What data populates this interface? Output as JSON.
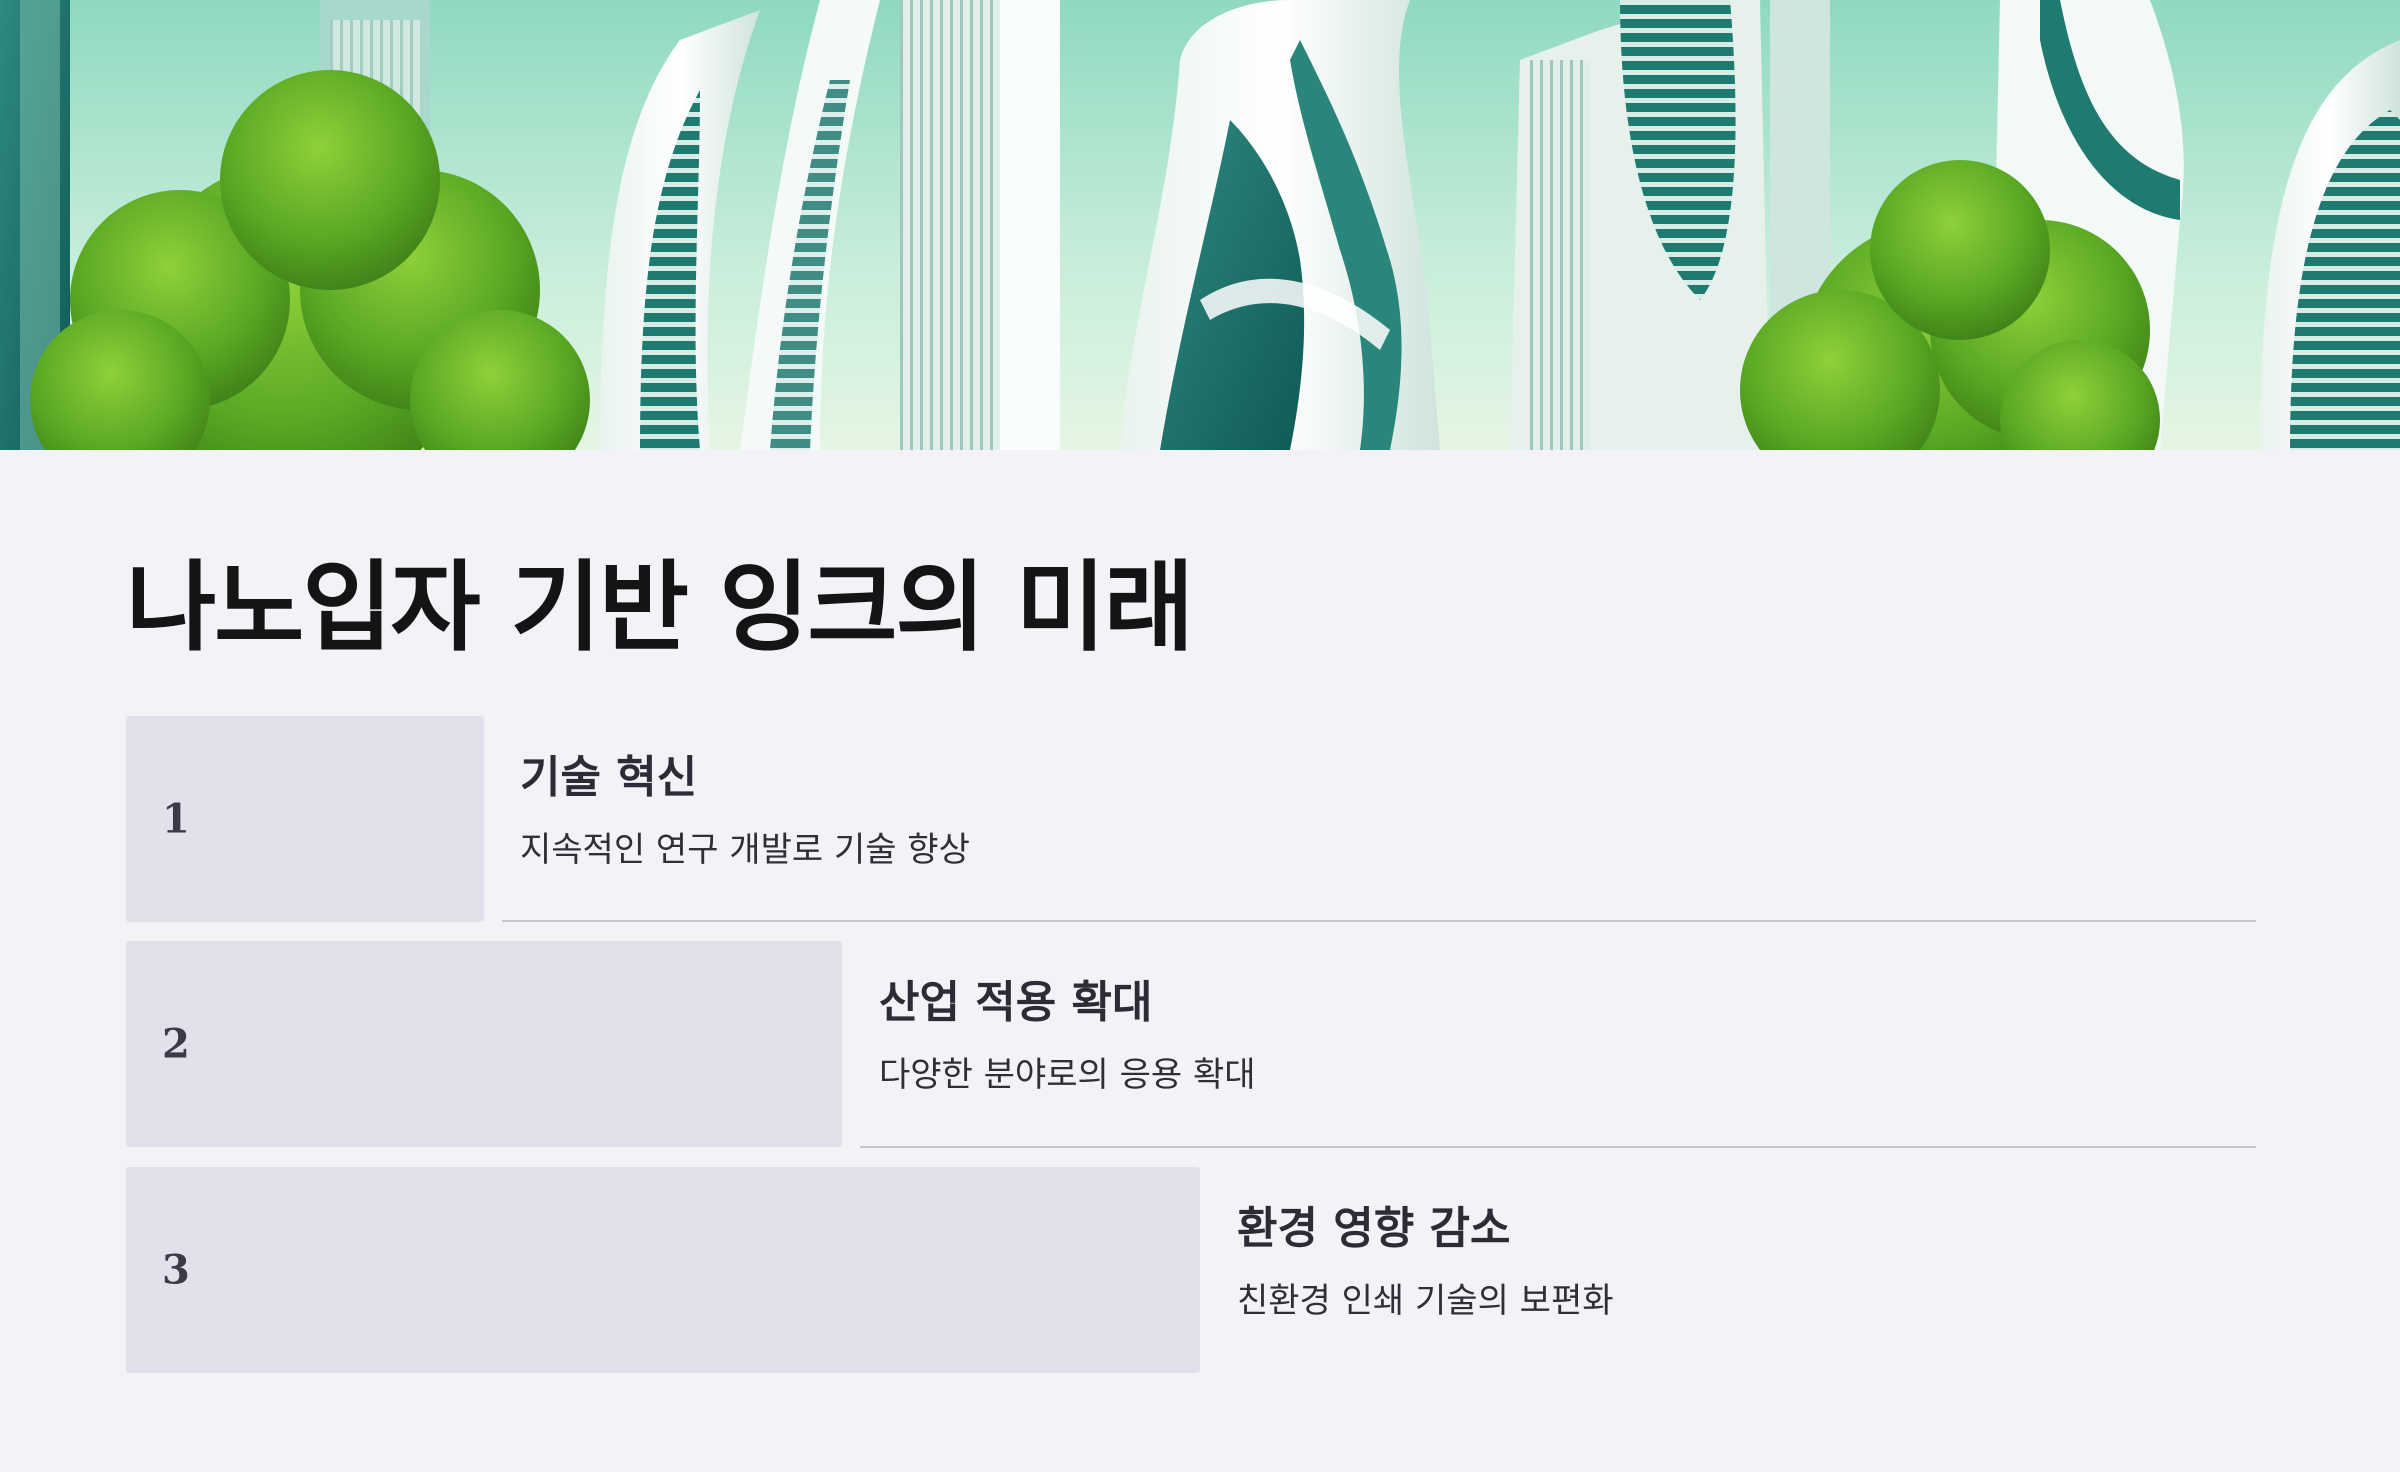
{
  "hero": {
    "image": "futuristic-eco-city-with-trees"
  },
  "title": "나노입자 기반 잉크의 미래",
  "steps": [
    {
      "number": "1",
      "title": "기술 혁신",
      "description": "지속적인 연구 개발로 기술 향상"
    },
    {
      "number": "2",
      "title": "산업 적용 확대",
      "description": "다양한 분야로의 응용 확대"
    },
    {
      "number": "3",
      "title": "환경 영향 감소",
      "description": "친환경 인쇄 기술의 보편화"
    }
  ],
  "colors": {
    "background": "#f2f2f7",
    "step_block": "#e1e1ec",
    "title_text": "#141414",
    "divider": "#c6c6cf"
  }
}
